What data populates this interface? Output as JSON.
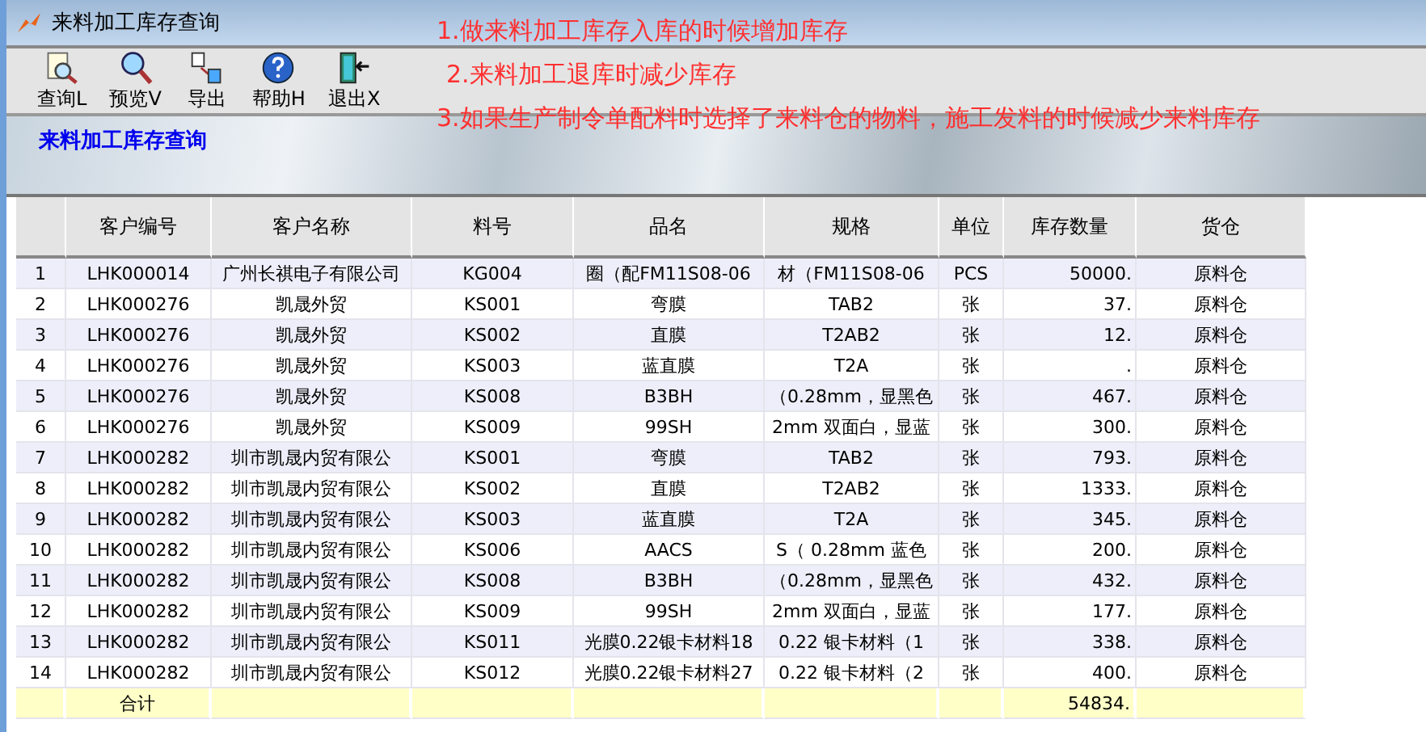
{
  "window": {
    "title": "来料加工库存查询"
  },
  "toolbar": [
    {
      "kind": "query",
      "label": "查询L"
    },
    {
      "kind": "preview",
      "label": "预览V"
    },
    {
      "kind": "export",
      "label": "导出"
    },
    {
      "kind": "help",
      "label": "帮助H"
    },
    {
      "kind": "exit",
      "label": "退出X"
    }
  ],
  "banner": {
    "title": "来料加工库存查询"
  },
  "annotations": [
    "1.做来料加工库存入库的时候增加库存",
    "2.来料加工退库时减少库存",
    "3.如果生产制令单配料时选择了来料仓的物料，施工发料的时候减少来料库存"
  ],
  "table": {
    "columns": [
      {
        "kind": "index"
      },
      {
        "label": "客户编号",
        "kind": "text"
      },
      {
        "label": "客户名称",
        "kind": "text"
      },
      {
        "label": "料号",
        "kind": "text"
      },
      {
        "label": "品名",
        "kind": "text"
      },
      {
        "label": "规格",
        "kind": "text"
      },
      {
        "label": "单位",
        "kind": "text"
      },
      {
        "label": "库存数量",
        "kind": "number"
      },
      {
        "label": "货仓",
        "kind": "text"
      }
    ],
    "rows": [
      [
        "1",
        "LHK000014",
        "广州长祺电子有限公司",
        "KG004",
        "圈（配FM11S08-06",
        "材（FM11S08-06",
        "PCS",
        "50000.",
        "原料仓"
      ],
      [
        "2",
        "LHK000276",
        "凯晟外贸",
        "KS001",
        "弯膜",
        "TAB2",
        "张",
        "37.",
        "原料仓"
      ],
      [
        "3",
        "LHK000276",
        "凯晟外贸",
        "KS002",
        "直膜",
        "T2AB2",
        "张",
        "12.",
        "原料仓"
      ],
      [
        "4",
        "LHK000276",
        "凯晟外贸",
        "KS003",
        "蓝直膜",
        "T2A",
        "张",
        ".",
        "原料仓"
      ],
      [
        "5",
        "LHK000276",
        "凯晟外贸",
        "KS008",
        "B3BH",
        "（0.28mm，显黑色",
        "张",
        "467.",
        "原料仓"
      ],
      [
        "6",
        "LHK000276",
        "凯晟外贸",
        "KS009",
        "99SH",
        "2mm 双面白，显蓝",
        "张",
        "300.",
        "原料仓"
      ],
      [
        "7",
        "LHK000282",
        "圳市凯晟内贸有限公",
        "KS001",
        "弯膜",
        "TAB2",
        "张",
        "793.",
        "原料仓"
      ],
      [
        "8",
        "LHK000282",
        "圳市凯晟内贸有限公",
        "KS002",
        "直膜",
        "T2AB2",
        "张",
        "1333.",
        "原料仓"
      ],
      [
        "9",
        "LHK000282",
        "圳市凯晟内贸有限公",
        "KS003",
        "蓝直膜",
        "T2A",
        "张",
        "345.",
        "原料仓"
      ],
      [
        "10",
        "LHK000282",
        "圳市凯晟内贸有限公",
        "KS006",
        "AACS",
        "S（ 0.28mm 蓝色",
        "张",
        "200.",
        "原料仓"
      ],
      [
        "11",
        "LHK000282",
        "圳市凯晟内贸有限公",
        "KS008",
        "B3BH",
        "（0.28mm，显黑色",
        "张",
        "432.",
        "原料仓"
      ],
      [
        "12",
        "LHK000282",
        "圳市凯晟内贸有限公",
        "KS009",
        "99SH",
        "2mm 双面白，显蓝",
        "张",
        "177.",
        "原料仓"
      ],
      [
        "13",
        "LHK000282",
        "圳市凯晟内贸有限公",
        "KS011",
        "光膜0.22银卡材料18",
        "0.22 银卡材料（1",
        "张",
        "338.",
        "原料仓"
      ],
      [
        "14",
        "LHK000282",
        "圳市凯晟内贸有限公",
        "KS012",
        "光膜0.22银卡材料27",
        "0.22 银卡材料（2",
        "张",
        "400.",
        "原料仓"
      ]
    ],
    "total": {
      "label": "合计",
      "quantity": "54834."
    }
  }
}
